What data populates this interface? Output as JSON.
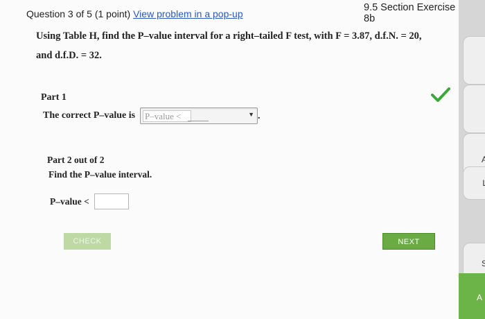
{
  "header": {
    "question": "Question 3 of 5 (1 point)",
    "popup_link": "View problem in a pop-up",
    "exercise": "9.5 Section Exercise 8b"
  },
  "problem": {
    "line1": "Using Table H, find the P–value interval for a right–tailed F test, with F = 3.87, d.f.N. = 20,",
    "line2": "and d.f.D. = 32."
  },
  "part1": {
    "label": "Part 1",
    "text": "The correct P–value is",
    "dropdown_value": "P–value <",
    "trailing": ".",
    "status": "correct"
  },
  "part2": {
    "label": "Part 2 out of 2",
    "instruction": "Find the P–value interval.",
    "input_label": "P–value <",
    "input_value": ""
  },
  "buttons": {
    "check": "CHECK",
    "next": "NEXT"
  },
  "side_tabs": {
    "tab_a": "A",
    "tab_l": "L",
    "tab_s": "S",
    "tab_a2": "A"
  },
  "colors": {
    "link": "#2a58c4",
    "checkmark": "#3aa935",
    "next_button": "#6bab44"
  }
}
